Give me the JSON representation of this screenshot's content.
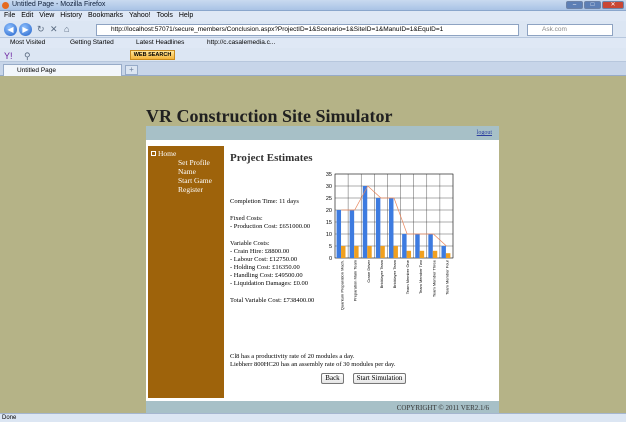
{
  "window": {
    "title": "Untitled Page - Mozilla Firefox",
    "min": "–",
    "max": "□",
    "close": "✕"
  },
  "menu": [
    "File",
    "Edit",
    "View",
    "History",
    "Bookmarks",
    "Yahoo!",
    "Tools",
    "Help"
  ],
  "nav": {
    "url": "http://localhost:57071/secure_members/Conclusion.aspx?ProjectID=1&Scenario=1&SiteID=1&ManuID=1&EquID=1",
    "search_placeholder": "Ask.com"
  },
  "bookmarks": [
    "Most Visited",
    "Getting Started",
    "Latest Headlines",
    "http://c.casalemedia.c..."
  ],
  "toolbar2": {
    "websearch": "WEB SEARCH"
  },
  "tab": {
    "title": "Untitled Page",
    "new_tab": "+"
  },
  "site": {
    "title": "VR Construction Site Simulator",
    "logout": "logout",
    "copyright": "COPYRIGHT © 2011 VER2.1/6"
  },
  "sidebar": {
    "items": [
      "Home",
      "Set Profile Name",
      "Start Game",
      "Register"
    ]
  },
  "estimates": {
    "title": "Project Estimates",
    "completion": "Completion Time: 11 days",
    "fixed_header": "Fixed Costs:",
    "production": "- Production Cost: £651000.00",
    "variable_header": "Variable Costs:",
    "crain": "- Crain Hire: £8800.00",
    "labour": "- Labour Cost: £12750.00",
    "holding": "- Holding Cost: £16350.00",
    "handling": "- Handling Cost: £49500.00",
    "liquidation": "- Liquidation Damages: £0.00",
    "total": "Total Variable Cost: £738400.00",
    "note1": "Cl8 has a productivity rate of 20 modules a day.",
    "note2": "Liebherr 800HC20 has an assembly rate of 30 modules per day."
  },
  "buttons": {
    "back": "Back",
    "start": "Start Simulation"
  },
  "status": "Done",
  "chart_data": {
    "type": "bar",
    "categories": [
      "Quantum Preparation Mach.",
      "Preparation Main Team",
      "Crane Driver",
      "Bricklayer Team",
      "Bricklayer Team",
      "Team Member One",
      "Team Member Two",
      "Team Member Three",
      "Team Member Four"
    ],
    "series": [
      {
        "color": "#3d7be0",
        "values": [
          20,
          20,
          30,
          25,
          25,
          10,
          10,
          10,
          5
        ]
      },
      {
        "color": "#f0a020",
        "values": [
          5,
          5,
          5,
          5,
          5,
          3,
          3,
          3,
          2
        ]
      }
    ],
    "line_values": [
      20,
      20,
      30,
      25,
      25,
      10,
      10,
      10,
      5
    ],
    "yticks": [
      "0",
      "5",
      "10",
      "15",
      "20",
      "25",
      "30",
      "35"
    ],
    "ylim": [
      0,
      35
    ],
    "grid": true
  }
}
